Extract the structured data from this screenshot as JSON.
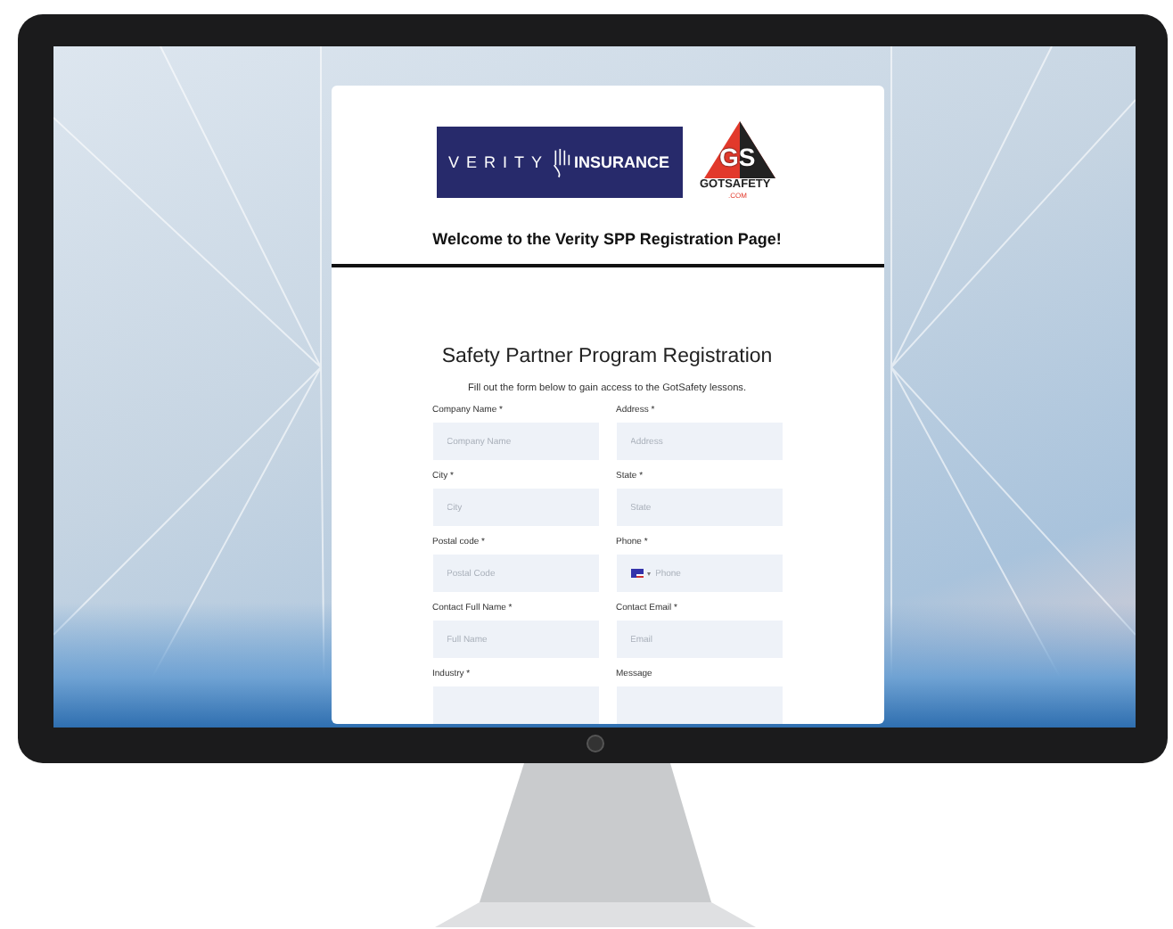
{
  "logos": {
    "verity": {
      "word_1": "VERITY",
      "word_2": "INSURANCE"
    },
    "gotsafety": {
      "mark": "GS",
      "name": "GOTSAFETY",
      "domain": ".COM"
    }
  },
  "welcome": "Welcome to the Verity SPP Registration Page!",
  "form": {
    "title": "Safety Partner Program Registration",
    "subtitle": "Fill out the form below to gain access to the GotSafety lessons.",
    "fields": [
      {
        "kind": "text",
        "label": "Company Name *",
        "placeholder": "Company Name"
      },
      {
        "kind": "text",
        "label": "Address *",
        "placeholder": "Address"
      },
      {
        "kind": "text",
        "label": "City *",
        "placeholder": "City"
      },
      {
        "kind": "text",
        "label": "State *",
        "placeholder": "State"
      },
      {
        "kind": "text",
        "label": "Postal code *",
        "placeholder": "Postal Code"
      },
      {
        "kind": "phone",
        "label": "Phone *",
        "placeholder": "Phone"
      },
      {
        "kind": "text",
        "label": "Contact Full Name *",
        "placeholder": "Full Name"
      },
      {
        "kind": "text",
        "label": "Contact Email *",
        "placeholder": "Email"
      },
      {
        "kind": "text",
        "label": "Industry *"
      },
      {
        "kind": "text",
        "label": "Message"
      }
    ]
  }
}
